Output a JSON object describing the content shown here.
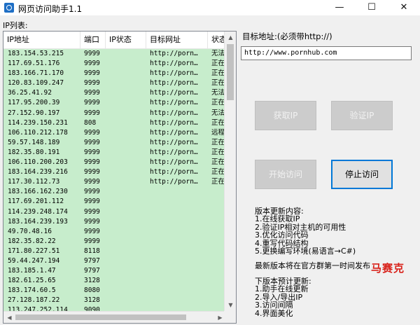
{
  "window": {
    "title": "网页访问助手1.1",
    "controls": {
      "minimize": "—",
      "maximize": "☐",
      "close": "✕"
    }
  },
  "ip_list": {
    "label": "IP列表:",
    "columns": [
      "IP地址",
      "端口",
      "IP状态",
      "目标网址",
      "状态"
    ],
    "rows": [
      [
        "183.154.53.215",
        "9999",
        "",
        "http://porn…",
        "无法…"
      ],
      [
        "117.69.51.176",
        "9999",
        "",
        "http://porn…",
        "正在…"
      ],
      [
        "183.166.71.170",
        "9999",
        "",
        "http://porn…",
        "正在…"
      ],
      [
        "120.83.109.247",
        "9999",
        "",
        "http://porn…",
        "正在…"
      ],
      [
        "36.25.41.92",
        "9999",
        "",
        "http://porn…",
        "无法…"
      ],
      [
        "117.95.200.39",
        "9999",
        "",
        "http://porn…",
        "正在…"
      ],
      [
        "27.152.90.197",
        "9999",
        "",
        "http://porn…",
        "无法…"
      ],
      [
        "114.239.150.231",
        "808",
        "",
        "http://porn…",
        "正在…"
      ],
      [
        "106.110.212.178",
        "9999",
        "",
        "http://porn…",
        "远程…"
      ],
      [
        "59.57.148.189",
        "9999",
        "",
        "http://porn…",
        "正在…"
      ],
      [
        "182.35.80.191",
        "9999",
        "",
        "http://porn…",
        "正在…"
      ],
      [
        "106.110.200.203",
        "9999",
        "",
        "http://porn…",
        "正在…"
      ],
      [
        "183.164.239.216",
        "9999",
        "",
        "http://porn…",
        "正在…"
      ],
      [
        "117.30.112.73",
        "9999",
        "",
        "http://porn…",
        "正在…"
      ],
      [
        "183.166.162.230",
        "9999",
        "",
        "",
        ""
      ],
      [
        "117.69.201.112",
        "9999",
        "",
        "",
        ""
      ],
      [
        "114.239.248.174",
        "9999",
        "",
        "",
        ""
      ],
      [
        "183.164.239.193",
        "9999",
        "",
        "",
        ""
      ],
      [
        "49.70.48.16",
        "9999",
        "",
        "",
        ""
      ],
      [
        "182.35.82.22",
        "9999",
        "",
        "",
        ""
      ],
      [
        "171.80.227.51",
        "8118",
        "",
        "",
        ""
      ],
      [
        "59.44.247.194",
        "9797",
        "",
        "",
        ""
      ],
      [
        "183.185.1.47",
        "9797",
        "",
        "",
        ""
      ],
      [
        "182.61.25.65",
        "3128",
        "",
        "",
        ""
      ],
      [
        "183.174.60.5",
        "8080",
        "",
        "",
        ""
      ],
      [
        "27.128.187.22",
        "3128",
        "",
        "",
        ""
      ],
      [
        "113.247.252.114",
        "9090",
        "",
        "",
        ""
      ]
    ]
  },
  "target": {
    "label": "目标地址:(必须带http://)",
    "url_value": "http://www.pornhub.com"
  },
  "buttons": {
    "get_ip": "获取IP",
    "verify_ip": "验证IP",
    "start_visit": "开始访问",
    "stop_visit": "停止访问"
  },
  "update_info": {
    "content_title": "版本更新内容:",
    "content_items": [
      "1.在线获取IP",
      "2.验证IP相对主机的可用性",
      "3.优化访问代码",
      "4.重写代码结构",
      "5.更换编写环境(易语言→C#)"
    ],
    "latest_notice": "最新版本将在官方群第一时间发布",
    "next_title": "下版本预计更新:",
    "next_items": [
      "1.助手在线更新",
      "2.导入/导出IP",
      "3.访问间隔",
      "4.界面美化"
    ]
  },
  "watermark": "马赛克",
  "colors": {
    "list_background": "#c7edcc",
    "accent_border": "#0078d7",
    "watermark": "#d9221b"
  }
}
